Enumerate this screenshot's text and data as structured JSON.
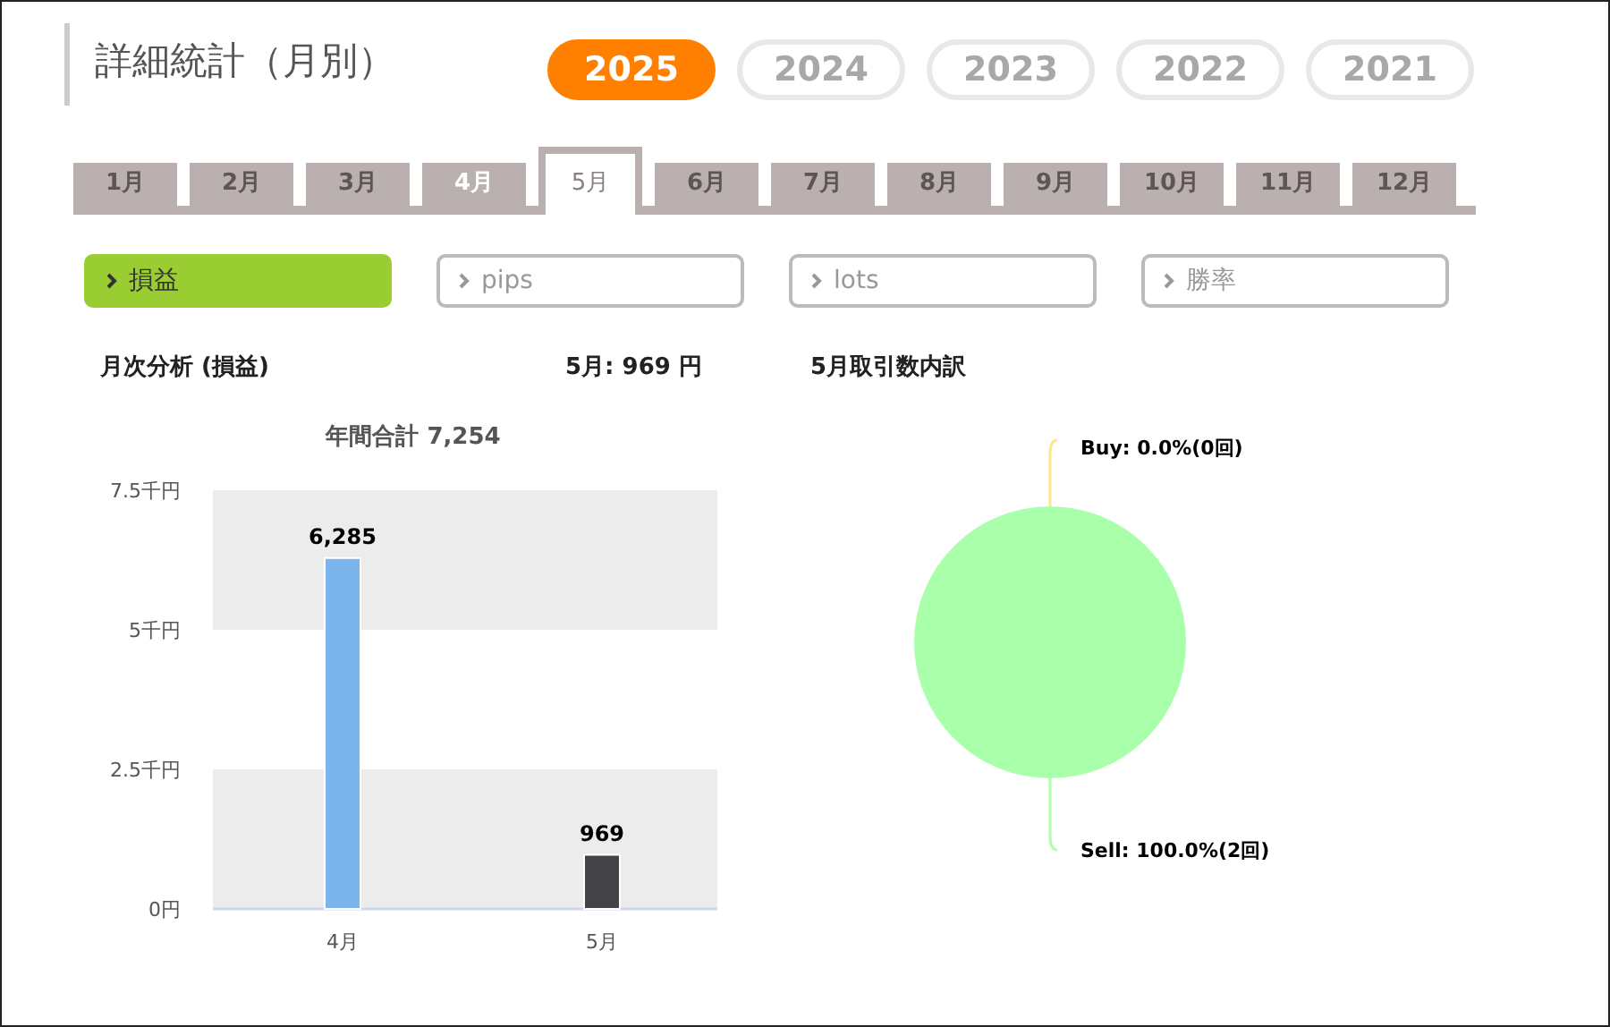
{
  "title": "詳細統計（月別）",
  "years": [
    {
      "label": "2025",
      "selected": true
    },
    {
      "label": "2024",
      "selected": false
    },
    {
      "label": "2023",
      "selected": false
    },
    {
      "label": "2022",
      "selected": false
    },
    {
      "label": "2021",
      "selected": false
    }
  ],
  "months": [
    {
      "label": "1月",
      "selected": false,
      "has_data": false
    },
    {
      "label": "2月",
      "selected": false,
      "has_data": false
    },
    {
      "label": "3月",
      "selected": false,
      "has_data": false
    },
    {
      "label": "4月",
      "selected": false,
      "has_data": true
    },
    {
      "label": "5月",
      "selected": true,
      "has_data": true
    },
    {
      "label": "6月",
      "selected": false,
      "has_data": false
    },
    {
      "label": "7月",
      "selected": false,
      "has_data": false
    },
    {
      "label": "8月",
      "selected": false,
      "has_data": false
    },
    {
      "label": "9月",
      "selected": false,
      "has_data": false
    },
    {
      "label": "10月",
      "selected": false,
      "has_data": false
    },
    {
      "label": "11月",
      "selected": false,
      "has_data": false
    },
    {
      "label": "12月",
      "selected": false,
      "has_data": false
    }
  ],
  "metrics": [
    {
      "label": "損益",
      "selected": true
    },
    {
      "label": "pips",
      "selected": false
    },
    {
      "label": "lots",
      "selected": false
    },
    {
      "label": "勝率",
      "selected": false
    }
  ],
  "monthly_heading": "月次分析 (損益)",
  "month_total": "5月:  969 円",
  "breakdown_heading": "5月取引数内訳",
  "bar_chart": {
    "chart_data": {
      "type": "bar",
      "title": "年間合計 7,254",
      "categories": [
        "4月",
        "5月"
      ],
      "series": [
        {
          "values": [
            6.285,
            0.969
          ]
        }
      ],
      "colors": [
        "#7cb5ec",
        "#434348"
      ],
      "ylim": [
        0,
        7.5
      ],
      "yticks": [
        {
          "value": 0,
          "label": "0円"
        },
        {
          "value": 2.5,
          "label": "2.5千円"
        },
        {
          "value": 5,
          "label": "5千円"
        },
        {
          "value": 7.5,
          "label": "7.5千円"
        }
      ],
      "value_labels": [
        "6,285",
        "969"
      ]
    }
  },
  "pie_chart": {
    "chart_data": {
      "type": "pie",
      "series": [
        {
          "values": [
            0,
            100
          ]
        }
      ],
      "colors": [
        "#ffe58a",
        "#aaffaa"
      ],
      "value_labels": [
        "Buy: 0.0%(0回)",
        "Sell: 100.0%(2回)"
      ]
    }
  }
}
